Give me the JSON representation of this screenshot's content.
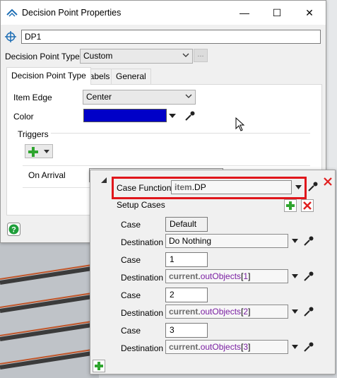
{
  "window": {
    "title": "Decision Point Properties",
    "minimize_glyph": "—",
    "maximize_glyph": "☐",
    "close_glyph": "✕"
  },
  "object": {
    "name": "DP1"
  },
  "type_row": {
    "label": "Decision Point Type",
    "value": "Custom",
    "more_button": "..."
  },
  "tabs": [
    {
      "label": "Decision Point Type",
      "active": true
    },
    {
      "label": "Labels",
      "active": false
    },
    {
      "label": "General",
      "active": false
    }
  ],
  "item_edge": {
    "label": "Item Edge",
    "value": "Center"
  },
  "color": {
    "label": "Color",
    "value": "#0000c8"
  },
  "triggers": {
    "label": "Triggers",
    "on_arrival_label": "On Arrival"
  },
  "popup": {
    "case_function": {
      "label": "Case Function",
      "code_object": "item",
      "code_dot": ".",
      "code_property": "DP"
    },
    "setup_cases_label": "Setup Cases",
    "cases": [
      {
        "case_label": "Case",
        "case_value": "Default",
        "dest_label": "Destination",
        "dest_plain": "Do Nothing"
      },
      {
        "case_label": "Case",
        "case_value": "1",
        "dest_label": "Destination",
        "dest_obj": "current",
        "dest_dot": ".",
        "dest_prop": "outObjects",
        "dest_open": "[",
        "dest_index": "1",
        "dest_close": "]"
      },
      {
        "case_label": "Case",
        "case_value": "2",
        "dest_label": "Destination",
        "dest_obj": "current",
        "dest_dot": ".",
        "dest_prop": "outObjects",
        "dest_open": "[",
        "dest_index": "2",
        "dest_close": "]"
      },
      {
        "case_label": "Case",
        "case_value": "3",
        "dest_label": "Destination",
        "dest_obj": "current",
        "dest_dot": ".",
        "dest_prop": "outObjects",
        "dest_open": "[",
        "dest_index": "3",
        "dest_close": "]"
      }
    ]
  },
  "colors": {
    "highlight_border": "#e0161b",
    "remove_red": "#e02020",
    "add_green": "#2fa52f",
    "help_green": "#1e9e3a",
    "swatch_blue": "#0000c8"
  }
}
